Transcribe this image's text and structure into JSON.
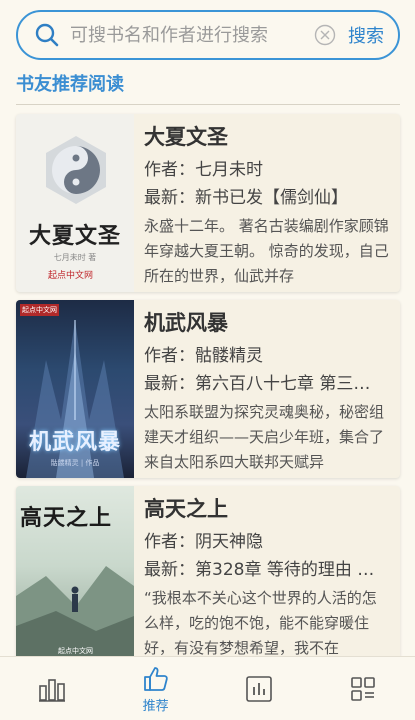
{
  "search": {
    "placeholder": "可搜书名和作者进行搜索",
    "value": "",
    "button_label": "搜索"
  },
  "section_title": "书友推荐阅读",
  "books": [
    {
      "title": "大夏文圣",
      "author": "作者：七月未时",
      "latest": "最新：新书已发【儒剑仙】",
      "desc": "永盛十二年。 著名古装编剧作家顾锦年穿越大夏王朝。 惊奇的发现，自己所在的世界，仙武并存",
      "cover_title": "大夏文圣",
      "cover_author": "七月未时 著",
      "cover_logo": "起点中文网"
    },
    {
      "title": "机武风暴",
      "author": "作者：骷髅精灵",
      "latest": "最新：第六百八十七章 第三…",
      "desc": "太阳系联盟为探究灵魂奥秘，秘密组建天才组织——天启少年班，集合了来自太阳系四大联邦天赋异",
      "cover_tag": "起点中文网",
      "cover_title": "机武风暴",
      "cover_author": "骷髅精灵 | 作品"
    },
    {
      "title": "高天之上",
      "author": "作者：阴天神隐",
      "latest": "最新：第328章 等待的理由 …",
      "desc": "“我根本不关心这个世界的人活的怎么样，吃的饱不饱，能不能穿暖住好，有没有梦想希望，我不在",
      "cover_title": "高天之上",
      "cover_logo": "起点中文网"
    }
  ],
  "nav": {
    "recommend_label": "推荐"
  },
  "colors": {
    "accent": "#2f84cc",
    "background": "#fbf8ef"
  }
}
